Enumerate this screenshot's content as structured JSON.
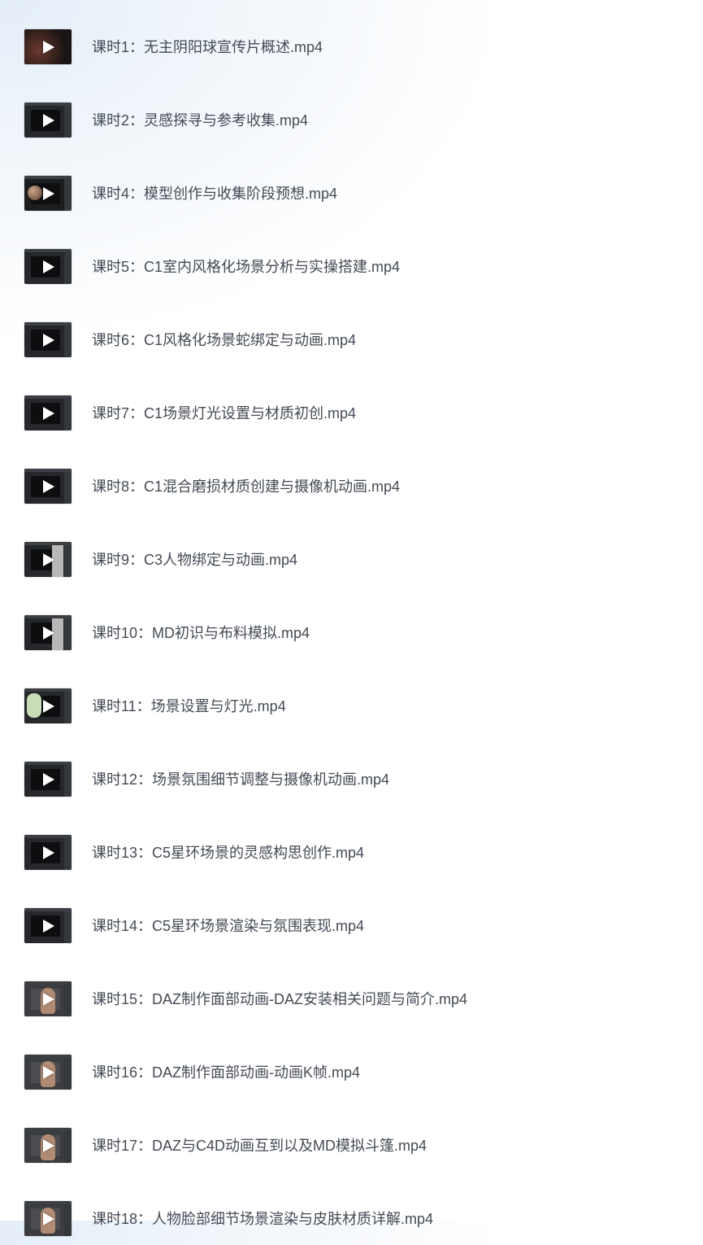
{
  "lessons": [
    {
      "label": "课时1：无主阴阳球宣传片概述.mp4",
      "thumb": "dark-scene"
    },
    {
      "label": "课时2：灵感探寻与参考收集.mp4",
      "thumb": "editor"
    },
    {
      "label": "课时4：模型创作与收集阶段预想.mp4",
      "thumb": "spheres"
    },
    {
      "label": "课时5：C1室内风格化场景分析与实操搭建.mp4",
      "thumb": "editor"
    },
    {
      "label": "课时6：C1风格化场景蛇绑定与动画.mp4",
      "thumb": "editor"
    },
    {
      "label": "课时7：C1场景灯光设置与材质初创.mp4",
      "thumb": "editor"
    },
    {
      "label": "课时8：C1混合磨损材质创建与摄像机动画.mp4",
      "thumb": "editor"
    },
    {
      "label": "课时9：C3人物绑定与动画.mp4",
      "thumb": "light-panel"
    },
    {
      "label": "课时10：MD初识与布料模拟.mp4",
      "thumb": "light-panel"
    },
    {
      "label": "课时11：场景设置与灯光.mp4",
      "thumb": "green"
    },
    {
      "label": "课时12：场景氛围细节调整与摄像机动画.mp4",
      "thumb": "editor"
    },
    {
      "label": "课时13：C5星环场景的灵感构思创作.mp4",
      "thumb": "editor"
    },
    {
      "label": "课时14：C5星环场景渲染与氛围表现.mp4",
      "thumb": "editor"
    },
    {
      "label": "课时15：DAZ制作面部动画-DAZ安装相关问题与简介.mp4",
      "thumb": "figure"
    },
    {
      "label": "课时16：DAZ制作面部动画-动画K帧.mp4",
      "thumb": "figure"
    },
    {
      "label": "课时17：DAZ与C4D动画互到以及MD模拟斗篷.mp4",
      "thumb": "figure"
    },
    {
      "label": "课时18：人物脸部细节场景渲染与皮肤材质详解.mp4",
      "thumb": "figure"
    }
  ]
}
